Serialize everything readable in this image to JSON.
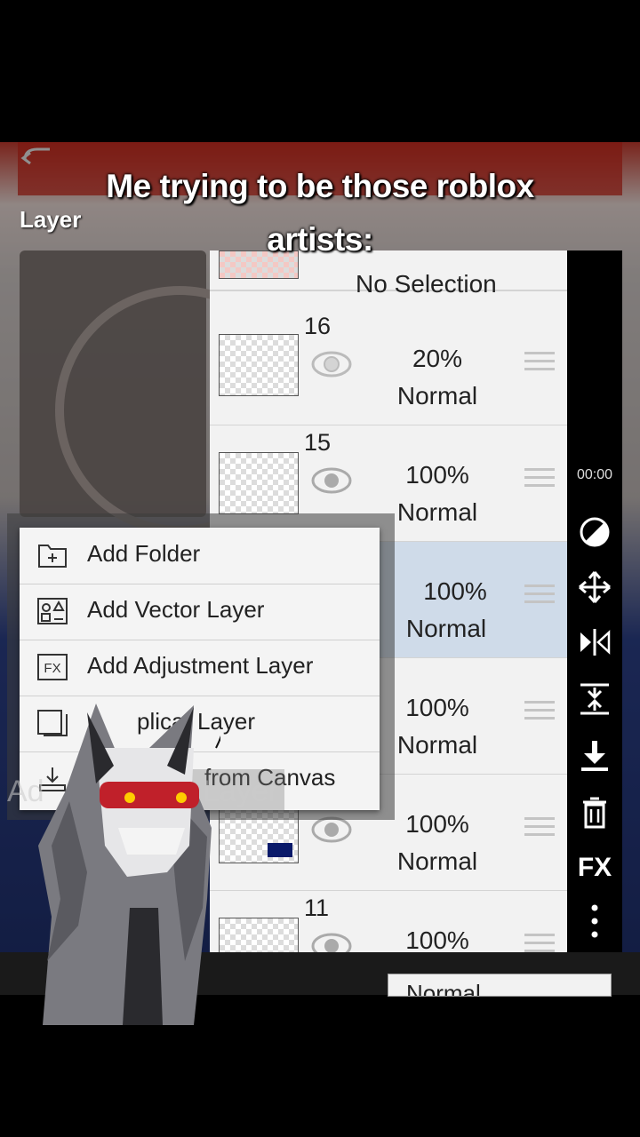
{
  "caption": {
    "line1": "Me trying to be those roblox",
    "line2": "artists:"
  },
  "panel": {
    "title": "Layer"
  },
  "layers": {
    "top_row": {
      "label": "No Selection"
    },
    "rows": [
      {
        "number": "16",
        "opacity": "20%",
        "blend": "Normal",
        "selected": false
      },
      {
        "number": "15",
        "opacity": "100%",
        "blend": "Normal",
        "selected": false
      },
      {
        "number": "",
        "opacity": "100%",
        "blend": "Normal",
        "selected": true
      },
      {
        "number": "",
        "opacity": "100%",
        "blend": "Normal",
        "selected": false
      },
      {
        "number": "",
        "opacity": "100%",
        "blend": "Normal",
        "selected": false
      },
      {
        "number": "11",
        "opacity": "100%",
        "blend": "",
        "selected": false
      }
    ]
  },
  "toolbar": {
    "timer": "00:00",
    "icons": [
      "opacity-icon",
      "move-icon",
      "flip-icon",
      "merge-down-icon",
      "download-icon",
      "trash-icon",
      "fx-icon",
      "more-icon"
    ],
    "fx_label": "FX"
  },
  "context_menu": {
    "items": [
      {
        "icon": "add-folder-icon",
        "label": "Add Folder"
      },
      {
        "icon": "vector-layer-icon",
        "label": "Add Vector Layer"
      },
      {
        "icon": "fx-icon",
        "icon_text": "FX",
        "label": "Add Adjustment Layer"
      },
      {
        "icon": "duplicate-icon",
        "label": "Duplicate Layer"
      },
      {
        "icon": "import-icon",
        "label": "Layer from Canvas"
      }
    ]
  },
  "overlay_text": {
    "duplicate_visible": "plica",
    "duplicate_tail": "Layer",
    "canvas_tail": "from Canvas",
    "ghost_add": "Ad",
    "ghost_layer": "Layer"
  },
  "bottom": {
    "blend_mode": "Normal"
  },
  "colors": {
    "selected_row": "#cfdbe9",
    "menu_bg": "#f4f4f4",
    "toolbar_bg": "#000000",
    "caption": "#ffffff"
  }
}
